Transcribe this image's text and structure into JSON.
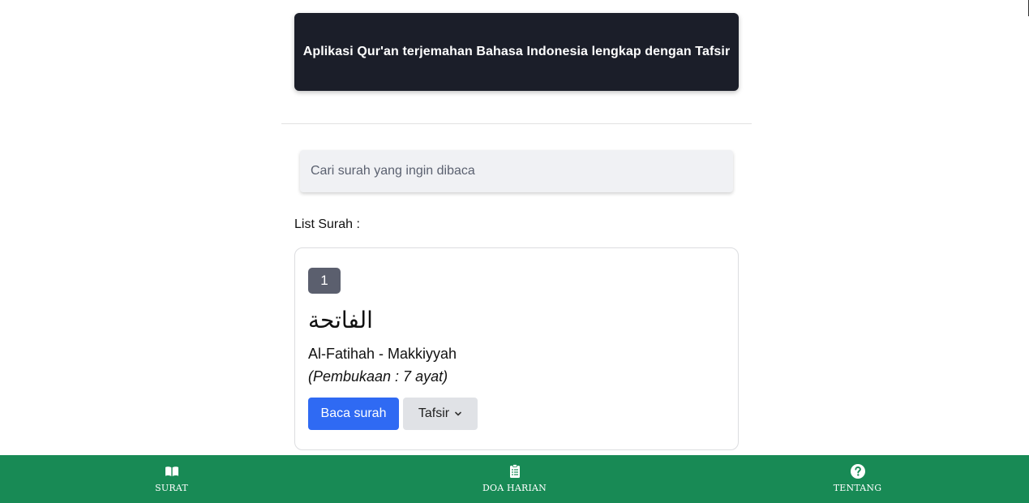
{
  "header": {
    "title": "Aplikasi Qur'an terjemahan Bahasa Indonesia lengkap dengan Tafsir"
  },
  "search": {
    "placeholder": "Cari surah yang ingin dibaca",
    "value": ""
  },
  "list": {
    "title": "List Surah :",
    "items": [
      {
        "number": "1",
        "arabic": "الفاتحة",
        "latin": "Al-Fatihah - Makkiyyah",
        "meaning": "(Pembukaan : 7 ayat)",
        "read_label": "Baca surah",
        "tafsir_label": "Tafsir"
      }
    ]
  },
  "bottom_nav": {
    "items": [
      {
        "label": "SURAT",
        "icon": "open-book-icon"
      },
      {
        "label": "DOA HARIAN",
        "icon": "clipboard-list-icon"
      },
      {
        "label": "TENTANG",
        "icon": "question-circle-icon"
      }
    ]
  },
  "colors": {
    "hero_bg": "#1b1e29",
    "primary_button": "#2f6af3",
    "nav_bg": "#188a55",
    "badge_bg": "#5b5f6e"
  }
}
